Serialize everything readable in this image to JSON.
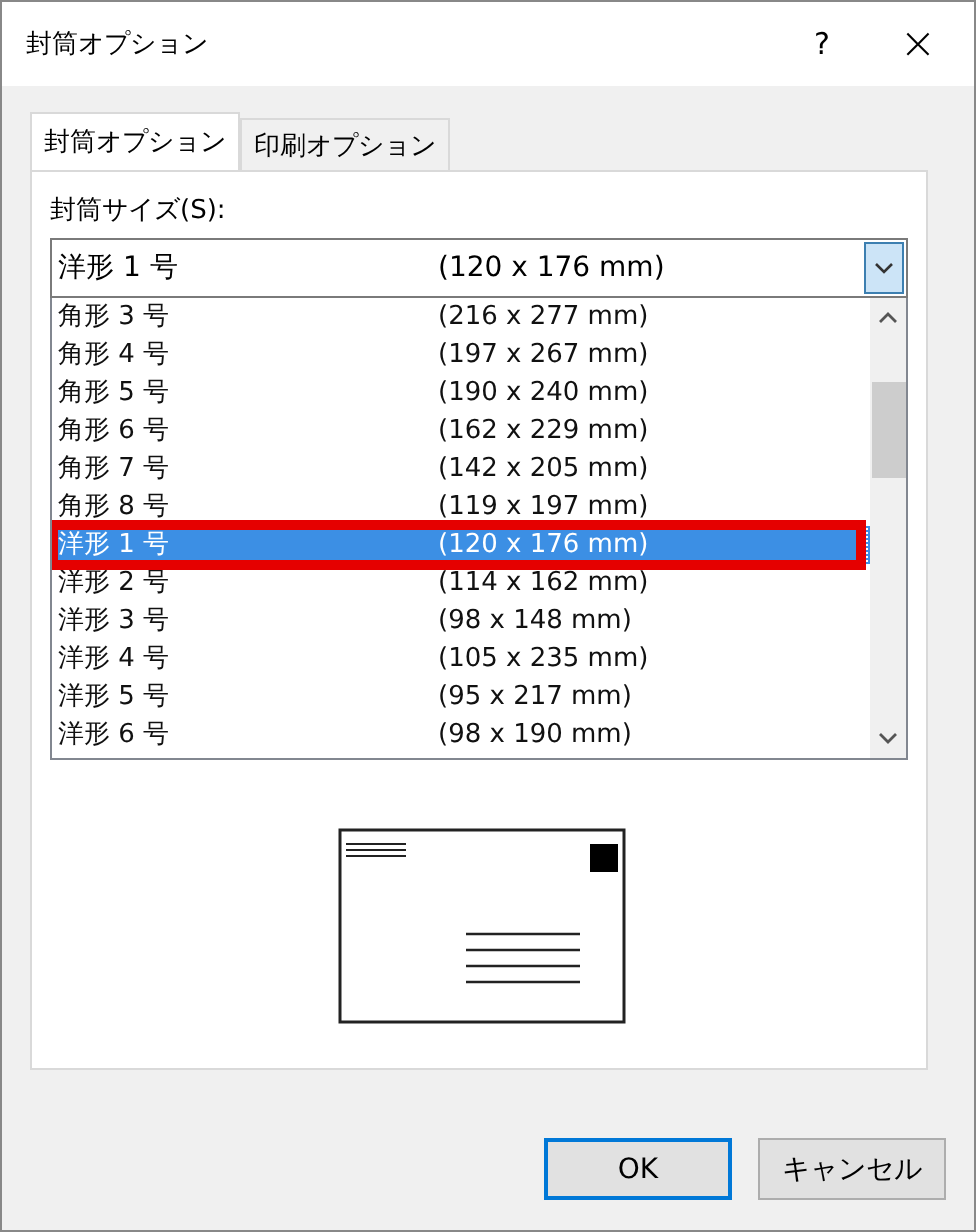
{
  "window": {
    "title": "封筒オプション",
    "help": "?",
    "close": "×"
  },
  "tabs": [
    {
      "label": "封筒オプション",
      "selected": true
    },
    {
      "label": "印刷オプション",
      "selected": false
    }
  ],
  "envelope_size": {
    "label": "封筒サイズ(S):",
    "value_name": "洋形 1 号",
    "value_size": "(120 x 176 mm)",
    "expanded": true
  },
  "list_items": [
    {
      "name": "角形 3 号",
      "size": "(216 x 277 mm)",
      "selected": false
    },
    {
      "name": "角形 4 号",
      "size": "(197 x 267 mm)",
      "selected": false
    },
    {
      "name": "角形 5 号",
      "size": "(190 x 240 mm)",
      "selected": false
    },
    {
      "name": "角形 6 号",
      "size": "(162 x 229 mm)",
      "selected": false
    },
    {
      "name": "角形 7 号",
      "size": "(142 x 205 mm)",
      "selected": false
    },
    {
      "name": "角形 8 号",
      "size": "(119 x 197 mm)",
      "selected": false
    },
    {
      "name": "洋形 1 号",
      "size": "(120 x 176 mm)",
      "selected": true
    },
    {
      "name": "洋形 2 号",
      "size": "(114 x 162 mm)",
      "selected": false
    },
    {
      "name": "洋形 3 号",
      "size": "(98 x 148 mm)",
      "selected": false
    },
    {
      "name": "洋形 4 号",
      "size": "(105 x 235 mm)",
      "selected": false
    },
    {
      "name": "洋形 5 号",
      "size": "(95 x 217 mm)",
      "selected": false
    },
    {
      "name": "洋形 6 号",
      "size": "(98 x 190 mm)",
      "selected": false
    }
  ],
  "buttons": [
    {
      "label": "OK",
      "kind": "default"
    },
    {
      "label": "キャンセル",
      "kind": "normal"
    }
  ]
}
